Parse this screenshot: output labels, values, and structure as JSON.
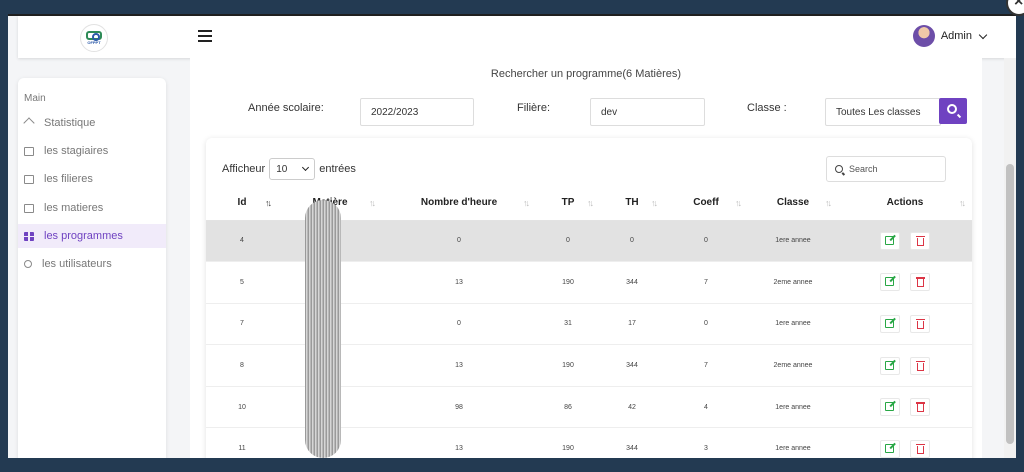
{
  "header": {
    "logo_text": "OFPPT",
    "user_name": "Admin",
    "colors": {
      "accent": "#6f42c1",
      "edit": "#28a745",
      "delete": "#dc3545"
    }
  },
  "sidebar": {
    "section_label": "Main",
    "items": [
      {
        "label": "Statistique",
        "icon": "home-icon",
        "active": false
      },
      {
        "label": "les stagiaires",
        "icon": "id-card-icon",
        "active": false
      },
      {
        "label": "les filieres",
        "icon": "list-icon",
        "active": false
      },
      {
        "label": "les matieres",
        "icon": "book-icon",
        "active": false
      },
      {
        "label": "les programmes",
        "icon": "grid-icon",
        "active": true
      },
      {
        "label": "les utilisateurs",
        "icon": "user-icon",
        "active": false
      }
    ]
  },
  "filters": {
    "title": "Rechercher un programme(6 Matières)",
    "annee_label": "Année scolaire:",
    "annee_value": "2022/2023",
    "filiere_label": "Filière:",
    "filiere_value": "dev",
    "classe_label": "Classe :",
    "classe_value": "Toutes Les classes"
  },
  "table": {
    "length_prefix": "Afficheur",
    "length_value": "10",
    "length_suffix": "entrées",
    "search_placeholder": "Search",
    "columns": [
      "Id",
      "Matière",
      "Nombre d'heure",
      "TP",
      "TH",
      "Coeff",
      "Classe",
      "Actions"
    ],
    "rows": [
      {
        "id": "4",
        "matiere": "",
        "heures": "0",
        "tp": "0",
        "th": "0",
        "coeff": "0",
        "classe": "1ere annee"
      },
      {
        "id": "5",
        "matiere": "",
        "heures": "13",
        "tp": "190",
        "th": "344",
        "coeff": "7",
        "classe": "2eme annee"
      },
      {
        "id": "7",
        "matiere": "",
        "heures": "0",
        "tp": "31",
        "th": "17",
        "coeff": "0",
        "classe": "1ere annee"
      },
      {
        "id": "8",
        "matiere": "",
        "heures": "13",
        "tp": "190",
        "th": "344",
        "coeff": "7",
        "classe": "2eme annee"
      },
      {
        "id": "10",
        "matiere": "",
        "heures": "98",
        "tp": "86",
        "th": "42",
        "coeff": "4",
        "classe": "1ere annee"
      },
      {
        "id": "11",
        "matiere": "",
        "heures": "13",
        "tp": "190",
        "th": "344",
        "coeff": "3",
        "classe": "1ere annee"
      }
    ]
  }
}
